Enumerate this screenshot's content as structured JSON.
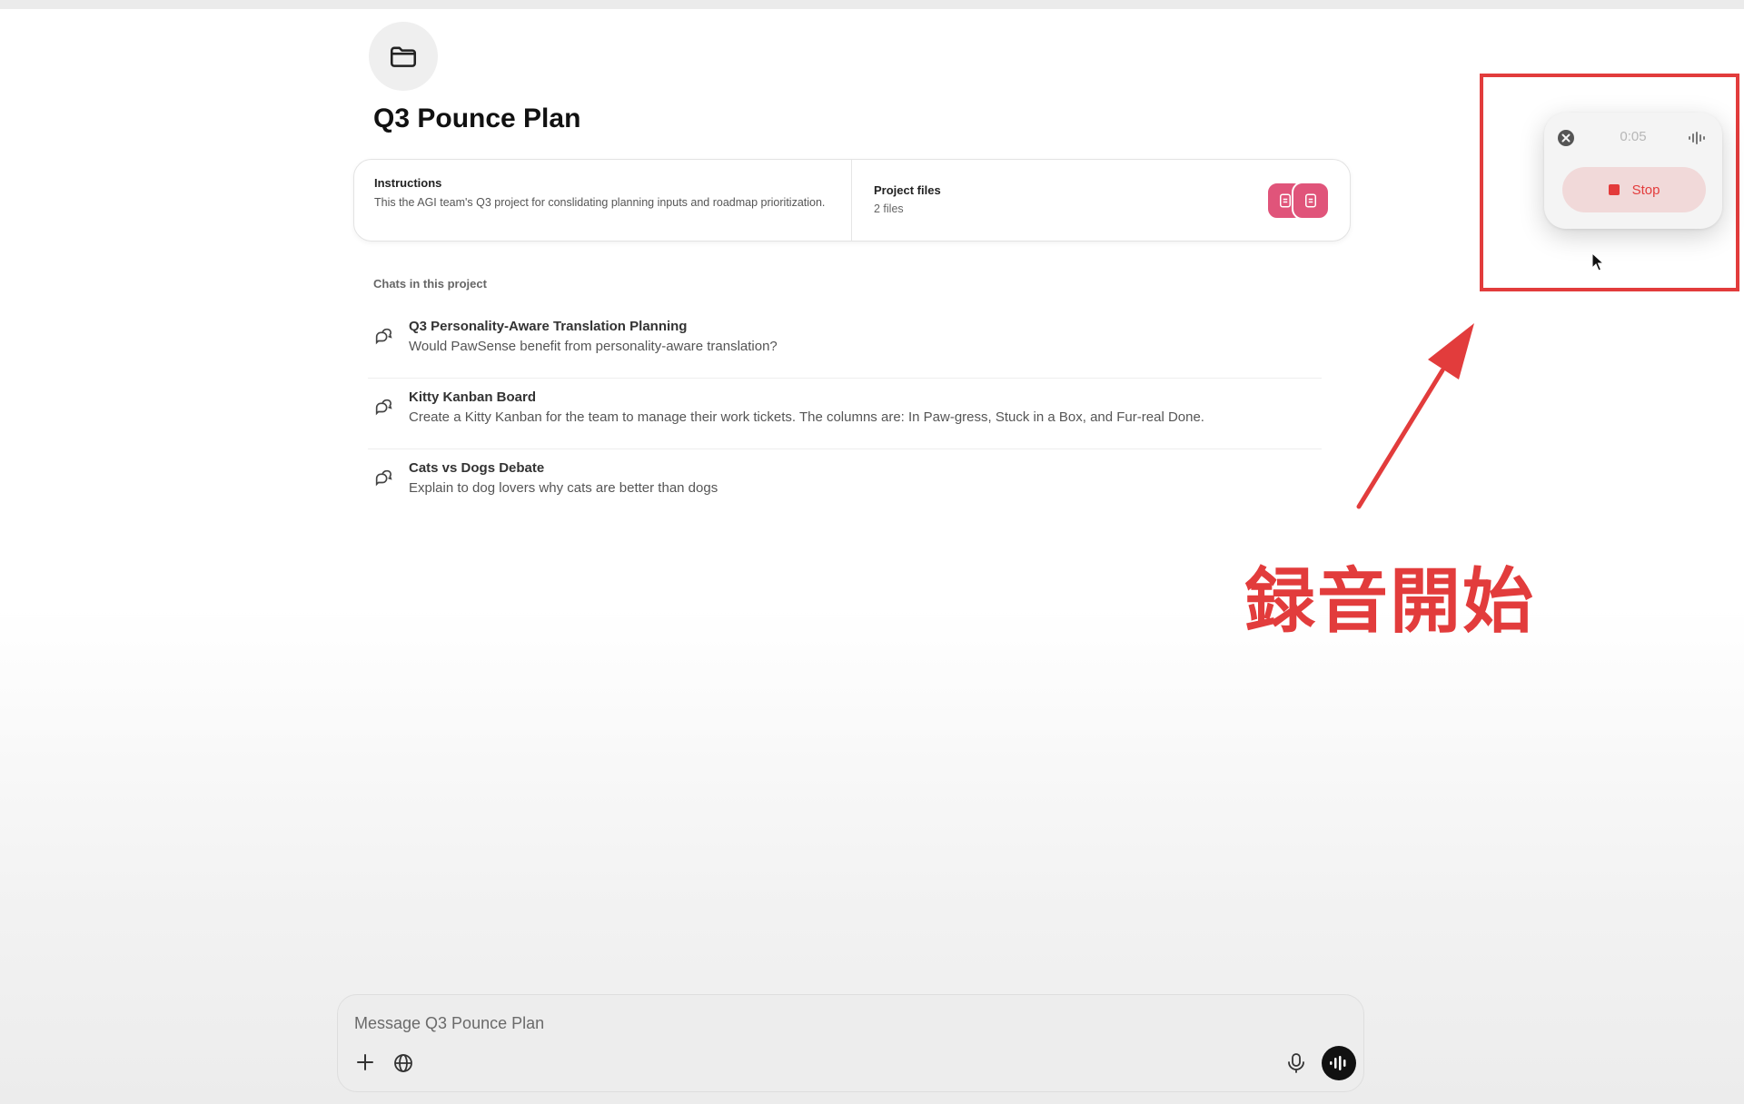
{
  "project": {
    "title": "Q3 Pounce Plan",
    "icon": "folder-icon"
  },
  "instructions": {
    "title": "Instructions",
    "text": "This the AGI team's Q3 project for conslidating planning inputs and roadmap prioritization."
  },
  "project_files": {
    "title": "Project files",
    "count": "2 files"
  },
  "chats": {
    "heading": "Chats in this project",
    "items": [
      {
        "title": "Q3 Personality-Aware Translation Planning",
        "subtitle": "Would PawSense benefit from personality-aware translation?"
      },
      {
        "title": "Kitty Kanban Board",
        "subtitle": "Create a Kitty Kanban for the team to manage their work tickets. The columns are: In Paw-gress, Stuck in a Box, and Fur-real Done."
      },
      {
        "title": "Cats vs Dogs Debate",
        "subtitle": "Explain to dog lovers why cats are better than dogs"
      }
    ]
  },
  "recording": {
    "timer": "0:05",
    "stop_label": "Stop"
  },
  "annotation": {
    "text": "録音開始"
  },
  "composer": {
    "placeholder": "Message Q3 Pounce Plan"
  },
  "colors": {
    "accent_red": "#e23c3c",
    "file_pink": "#e0547a",
    "stop_bg": "#f1d9d9"
  }
}
